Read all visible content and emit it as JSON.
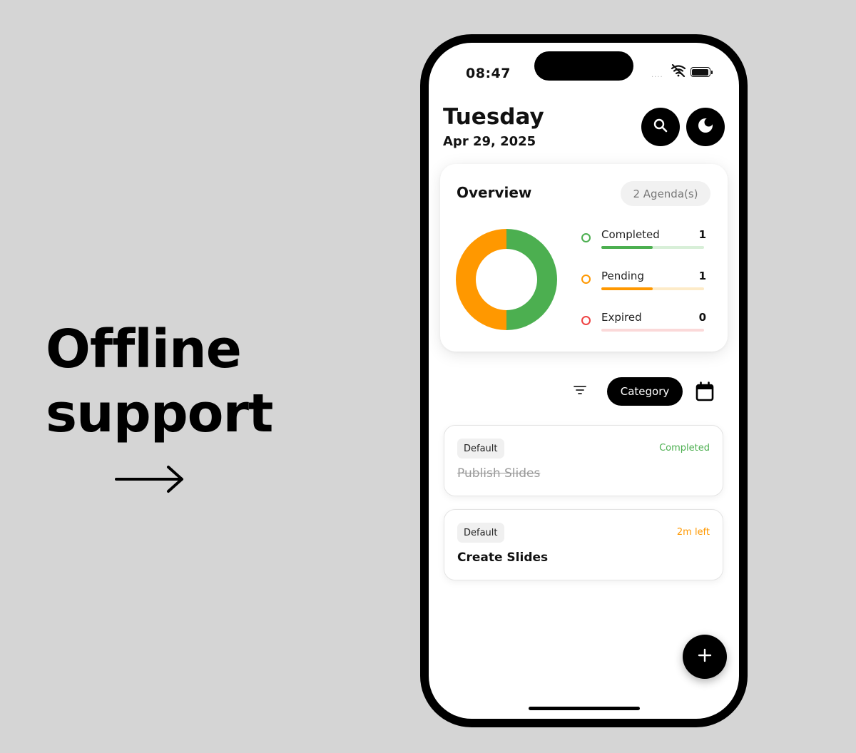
{
  "promo": {
    "line1": "Offline",
    "line2": "support",
    "arrow_icon": "right-arrow-icon"
  },
  "status_bar": {
    "time": "08:47",
    "signal_dots": "....",
    "icons": [
      "wifi-off-icon",
      "battery-icon"
    ]
  },
  "header": {
    "day": "Tuesday",
    "date": "Apr 29, 2025",
    "search_icon": "search-icon",
    "theme_icon": "moon-icon"
  },
  "overview": {
    "title": "Overview",
    "agenda_count": "2 Agenda(s)",
    "stats": [
      {
        "label": "Completed",
        "count": "1",
        "fraction": 0.5,
        "color": "#4caf50",
        "track_color": "#d8efd8"
      },
      {
        "label": "Pending",
        "count": "1",
        "fraction": 0.5,
        "color": "#ff9800",
        "track_color": "#fdebc8"
      },
      {
        "label": "Expired",
        "count": "0",
        "fraction": 0,
        "color": "#ef4444",
        "track_color": "#fbd9d9"
      }
    ]
  },
  "filters": {
    "filter_icon": "filter-icon",
    "category_label": "Category",
    "calendar_icon": "calendar-icon"
  },
  "agendas": [
    {
      "tag": "Default",
      "status": "Completed",
      "status_color": "#4caf50",
      "title": "Publish Slides",
      "done": true
    },
    {
      "tag": "Default",
      "status": "2m left",
      "status_color": "#ff9800",
      "title": "Create Slides",
      "done": false
    }
  ],
  "fab_icon": "plus-icon",
  "colors": {
    "accent": "#000000",
    "completed": "#4caf50",
    "pending": "#ff9800",
    "expired": "#ef4444"
  }
}
